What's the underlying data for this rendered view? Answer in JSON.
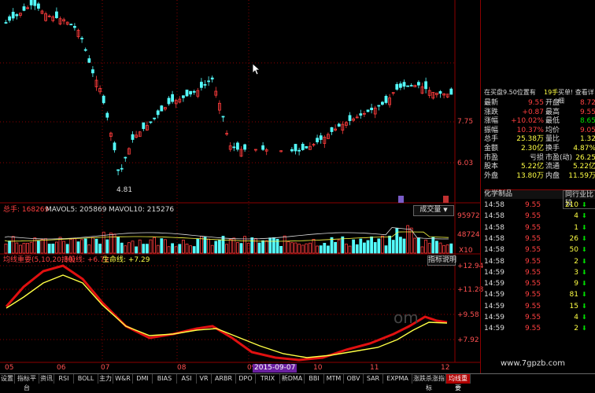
{
  "price_panel": {
    "low_marker": "4.81",
    "levels": [
      "7.75",
      "6.03"
    ]
  },
  "volume_panel": {
    "header": "总手: 168269",
    "mavol5": "MAVOL5: 205869",
    "mavol10": "MAVOL10: 215276",
    "selector": "成交量",
    "levels": [
      "95972",
      "48724",
      "X10"
    ]
  },
  "indicator_panel": {
    "title": "均线重要(5,10,20,30)",
    "line1": "持股线: +6.72",
    "line2": "生命线: +7.29",
    "help_button": "指标说明",
    "levels": [
      "+12.94",
      "+11.28",
      "+9.58",
      "+7.92"
    ],
    "watermark": "om"
  },
  "xaxis": {
    "labels": [
      "05",
      "06",
      "07",
      "08",
      "09",
      "10",
      "11",
      "12"
    ],
    "cursor_date": "2015-09-07"
  },
  "quote": {
    "header_left": "在买盘9.50位置有",
    "header_mid": "19手",
    "header_right": "买单! 查看详细",
    "rows": [
      {
        "l1": "最新",
        "v1": "9.55",
        "l2": "开盘",
        "v2": "8.72"
      },
      {
        "l1": "涨跌",
        "v1": "+0.87",
        "l2": "最高",
        "v2": "9.55"
      },
      {
        "l1": "涨幅",
        "v1": "+10.02%",
        "l2": "最低",
        "v2": "8.65"
      },
      {
        "l1": "振幅",
        "v1": "10.37%",
        "l2": "均价",
        "v2": "9.05"
      },
      {
        "l1": "总手",
        "v1": "25.38万",
        "l2": "量比",
        "v2": "1.32"
      },
      {
        "l1": "金额",
        "v1": "2.30亿",
        "l2": "换手",
        "v2": "4.87%"
      },
      {
        "l1": "市盈",
        "v1": "亏损",
        "l2": "市盈(动)",
        "v2": "26.25"
      },
      {
        "l1": "股本",
        "v1": "5.22亿",
        "l2": "流通",
        "v2": "5.22亿"
      },
      {
        "l1": "外盘",
        "v1": "13.80万",
        "l2": "内盘",
        "v2": "11.59万"
      }
    ],
    "sector": "化学制品",
    "compare_button": "同行业比较"
  },
  "trades": [
    {
      "time": "14:58",
      "price": "9.55",
      "vol": "210"
    },
    {
      "time": "14:58",
      "price": "9.55",
      "vol": "4"
    },
    {
      "time": "14:58",
      "price": "9.55",
      "vol": "1"
    },
    {
      "time": "14:58",
      "price": "9.55",
      "vol": "26"
    },
    {
      "time": "14:58",
      "price": "9.55",
      "vol": "50"
    },
    {
      "time": "14:58",
      "price": "9.55",
      "vol": "2"
    },
    {
      "time": "14:59",
      "price": "9.55",
      "vol": "3"
    },
    {
      "time": "14:59",
      "price": "9.55",
      "vol": "9"
    },
    {
      "time": "14:59",
      "price": "9.55",
      "vol": "81"
    },
    {
      "time": "14:59",
      "price": "9.55",
      "vol": "15"
    },
    {
      "time": "14:59",
      "price": "9.55",
      "vol": "4"
    },
    {
      "time": "14:59",
      "price": "9.55",
      "vol": "2"
    }
  ],
  "bottom_tabs": [
    "设置",
    "指标平台",
    "资讯",
    "RSI",
    "BOLL",
    "主力",
    "W&R",
    "DMI",
    "BIAS",
    "ASI",
    "VR",
    "ARBR",
    "DPO",
    "TRIX",
    "新DMA",
    "BBI",
    "MTM",
    "OBV",
    "SAR",
    "EXPMA",
    "涨跌杀涨指标",
    "均线重要"
  ],
  "site_watermark": "www.7gpzb.com",
  "colors": {
    "up": "#ff3c3c",
    "down": "#54fcfc",
    "yellow": "#ffff44",
    "green": "#00e000",
    "grid": "#8b0000"
  }
}
